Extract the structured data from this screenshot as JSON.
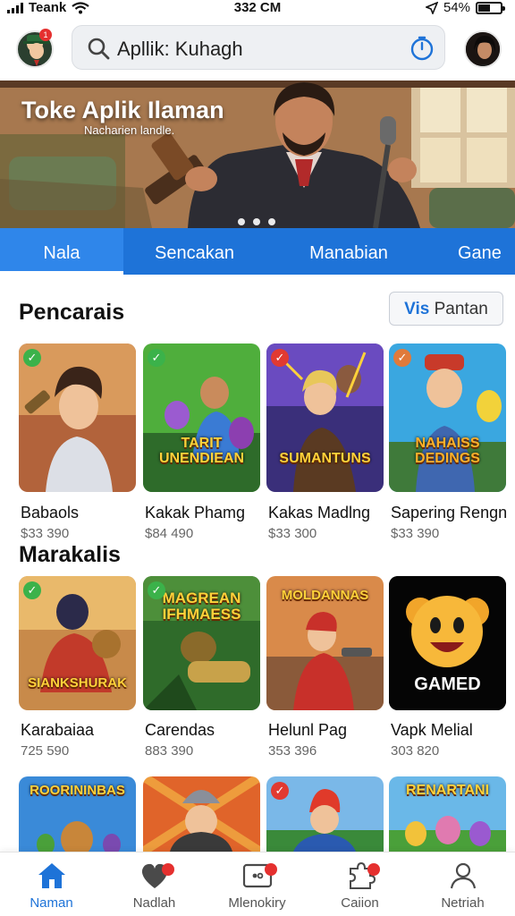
{
  "status_bar": {
    "carrier": "Teank",
    "time": "332 CM",
    "battery": "54%"
  },
  "header": {
    "search_text": "Apllik: Kuhagh",
    "left_avatar_badge": "1"
  },
  "banner": {
    "title": "Toke Aplik Ilaman",
    "subtitle": "Nacharien landle."
  },
  "tabs": [
    "Nala",
    "Sencakan",
    "Manabian",
    "Gane"
  ],
  "sections": [
    {
      "title": "Pencarais",
      "see_all_prefix": "Vis",
      "see_all_suffix": " Pantan",
      "apps": [
        {
          "name": "Babaols",
          "price": "$33 390",
          "logo": ""
        },
        {
          "name": "Kakak Phamg",
          "price": "$84 490",
          "logo": "TARIT UNENDIEAN"
        },
        {
          "name": "Kakas Madlng",
          "price": "$33 300",
          "logo": "SUMANTUNS"
        },
        {
          "name": "Sapering Rengn",
          "price": "$33 390",
          "logo": "NAHAISS DEDINGS"
        }
      ]
    },
    {
      "title": "Marakalis",
      "apps": [
        {
          "name": "Karabaiaa",
          "price": "725 590",
          "logo": "SIANKSHURAK"
        },
        {
          "name": "Carendas",
          "price": "883 390",
          "logo": "MAGREAN IFHMAESS"
        },
        {
          "name": "Helunl Pag",
          "price": "353 396",
          "logo": "MOLDANNAS"
        },
        {
          "name": "Vapk Melial",
          "price": "303 820",
          "logo": "GAMED"
        }
      ]
    },
    {
      "apps": [
        {
          "logo": "ROORININBAS"
        },
        {
          "logo": ""
        },
        {
          "logo": ""
        },
        {
          "logo": "RENARTANI"
        }
      ]
    }
  ],
  "bottom_nav": [
    {
      "label": "Naman",
      "icon": "home-icon"
    },
    {
      "label": "Nadlah",
      "icon": "heart-icon"
    },
    {
      "label": "Mlenokiry",
      "icon": "inbox-icon"
    },
    {
      "label": "Caiion",
      "icon": "puzzle-icon"
    },
    {
      "label": "Netriah",
      "icon": "person-icon"
    }
  ],
  "colors": {
    "accent": "#1e73d8",
    "badge": "#e5302f",
    "check_green": "#3bb24a"
  }
}
